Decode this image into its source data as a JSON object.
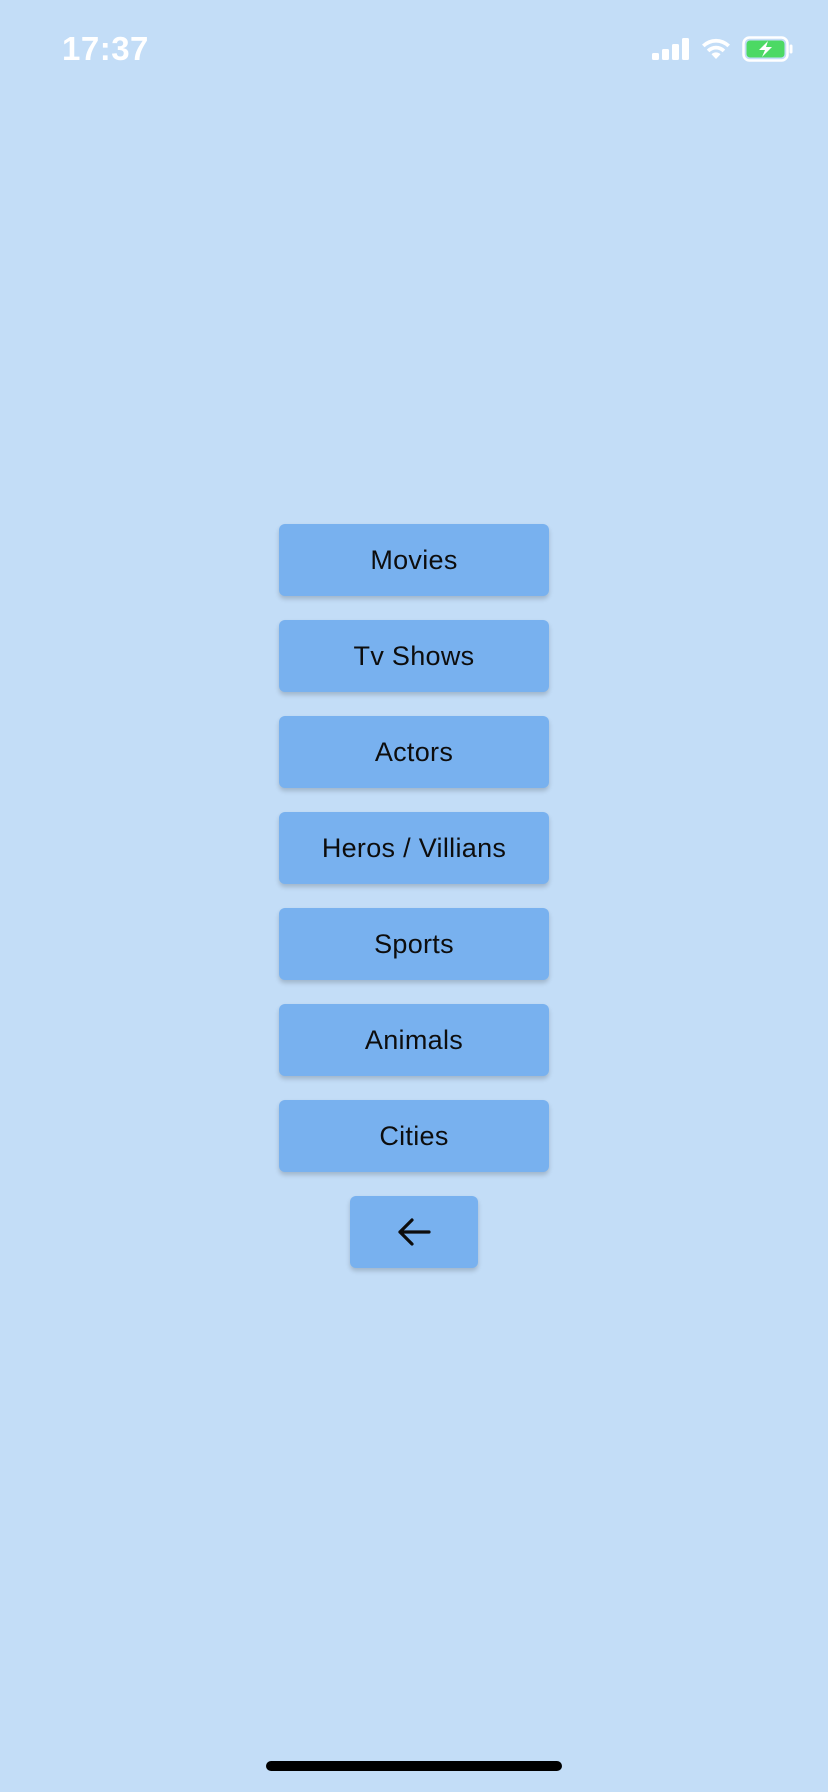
{
  "status_bar": {
    "time": "17:37",
    "icons": [
      "signal-icon",
      "wifi-icon",
      "battery-charging-icon"
    ],
    "battery_color": "#4cd964"
  },
  "menu": {
    "items": [
      {
        "label": "Movies"
      },
      {
        "label": "Tv Shows"
      },
      {
        "label": "Actors"
      },
      {
        "label": "Heros / Villians"
      },
      {
        "label": "Sports"
      },
      {
        "label": "Animals"
      },
      {
        "label": "Cities"
      }
    ],
    "back_icon": "arrow-left-icon"
  },
  "colors": {
    "background": "#c3ddf7",
    "button": "#78b1ef",
    "text": "#0d0d0d"
  }
}
